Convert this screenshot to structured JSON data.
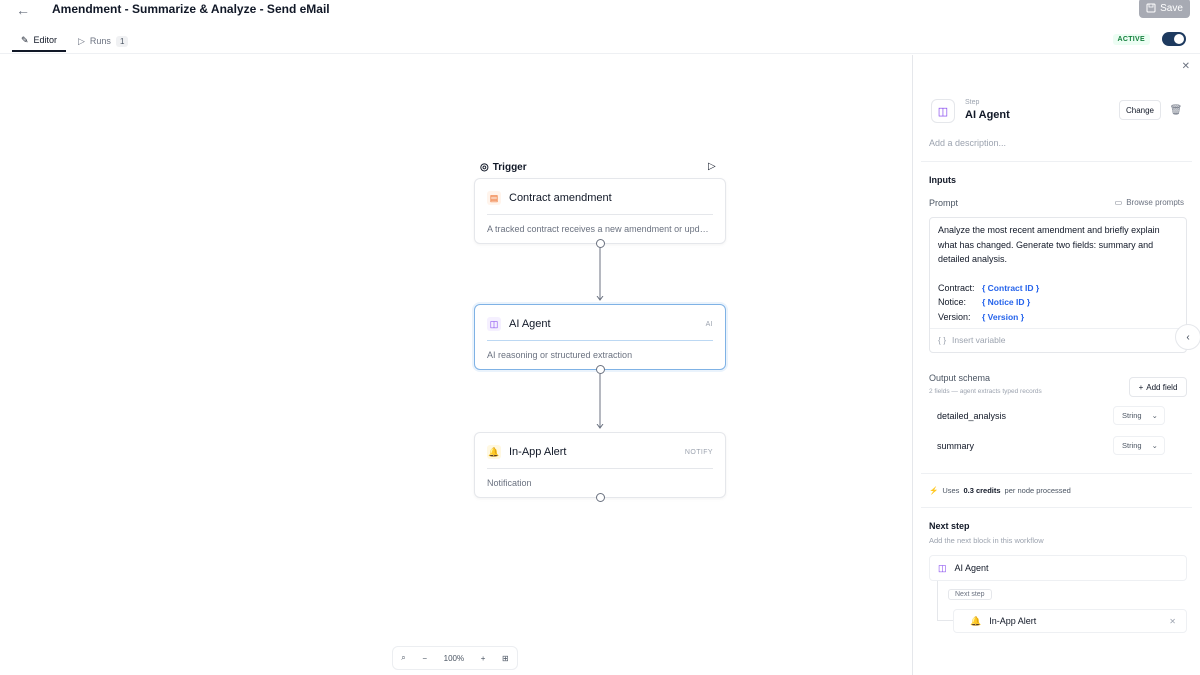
{
  "header": {
    "title": "Amendment - Summarize & Analyze - Send eMail",
    "save_label": "Save"
  },
  "tabs": {
    "editor": "Editor",
    "runs": "Runs",
    "runs_count": "1"
  },
  "status": {
    "badge": "ACTIVE",
    "enabled": true
  },
  "canvas": {
    "trigger_label": "Trigger",
    "nodes": [
      {
        "title": "Contract amendment",
        "tag": "",
        "desc": "A tracked contract receives a new amendment or upd…",
        "icon": "document-icon"
      },
      {
        "title": "AI Agent",
        "tag": "AI",
        "desc": "AI reasoning or structured extraction",
        "icon": "robot-icon"
      },
      {
        "title": "In-App Alert",
        "tag": "NOTIFY",
        "desc": "Notification",
        "icon": "bell-icon"
      }
    ],
    "zoom": "100%"
  },
  "panel": {
    "kicker": "Step",
    "title": "AI Agent",
    "change_label": "Change",
    "description_placeholder": "Add a description...",
    "inputs_title": "Inputs",
    "prompt_label": "Prompt",
    "browse_label": "Browse prompts",
    "prompt_lines": [
      "Analyze the most recent amendment and briefly explain",
      "what has changed. Generate two fields: summary and",
      "detailed analysis."
    ],
    "variables": [
      {
        "key": "Contract:",
        "value": "{ Contract ID }"
      },
      {
        "key": "Notice:",
        "value": "{ Notice ID }"
      },
      {
        "key": "Version:",
        "value": "{ Version }"
      }
    ],
    "insert_variable": "Insert variable",
    "schema_label": "Output schema",
    "schema_sub": "2 fields — agent extracts typed records",
    "add_field_label": "Add field",
    "fields": [
      {
        "name": "detailed_analysis",
        "type": "String"
      },
      {
        "name": "summary",
        "type": "String"
      }
    ],
    "credits_prefix": "Uses",
    "credits_value": "0.3 credits",
    "credits_suffix": "per node processed",
    "next_title": "Next step",
    "next_sub": "Add the next block in this workflow",
    "next_card": "AI Agent",
    "next_tag": "Next step",
    "next_child": "In-App Alert"
  }
}
